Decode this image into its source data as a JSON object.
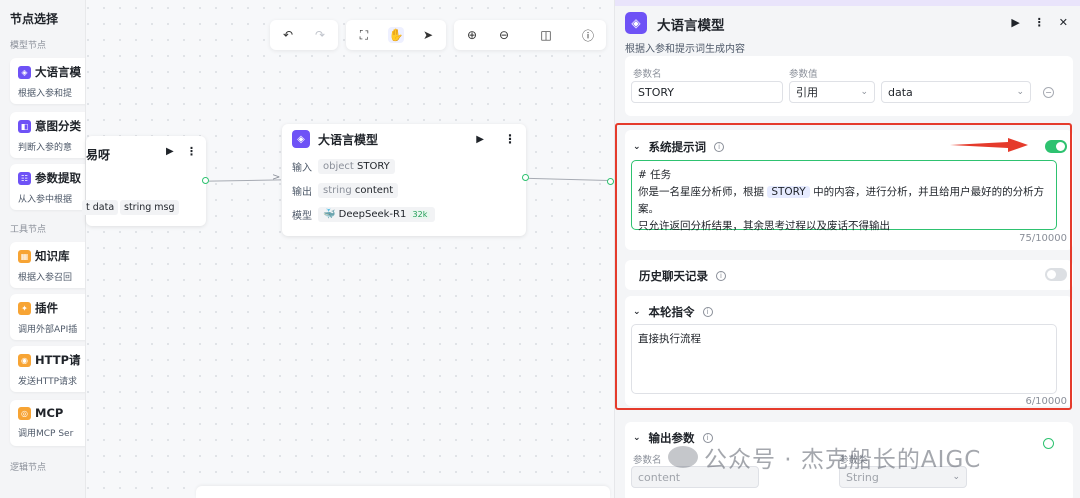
{
  "left_panel": {
    "title": "节点选择",
    "sections": [
      "模型节点",
      "工具节点",
      "逻辑节点"
    ],
    "items": [
      {
        "icon": "llm-icon",
        "label": "大语言模",
        "desc": "根据入参和提"
      },
      {
        "icon": "intent-icon",
        "label": "意图分类",
        "desc": "判断入参的意"
      },
      {
        "icon": "param-icon",
        "label": "参数提取",
        "desc": "从入参中根据"
      },
      {
        "icon": "knowledge-icon",
        "label": "知识库",
        "desc": "根据入参召回"
      },
      {
        "icon": "plugin-icon",
        "label": "插件",
        "desc": "调用外部API插"
      },
      {
        "icon": "http-icon",
        "label": "HTTP请",
        "desc": "发送HTTP请求"
      },
      {
        "icon": "mcp-icon",
        "label": "MCP",
        "desc": "调用MCP Ser"
      }
    ]
  },
  "toolbar": {
    "icons": [
      "undo-icon",
      "redo-icon",
      "fullscreen-icon",
      "hand-icon",
      "pointer-icon",
      "zoom-in-icon",
      "zoom-out-icon",
      "layout-icon",
      "help-icon"
    ]
  },
  "node_left": {
    "title": "易呀",
    "inputs": [
      "t data",
      "string msg"
    ]
  },
  "node_main": {
    "title": "大语言模型",
    "input_label": "输入",
    "input_type": "object",
    "input_name": "STORY",
    "output_label": "输出",
    "output_type": "string",
    "output_name": "content",
    "model_label": "模型",
    "model_name": "DeepSeek-R1",
    "model_badge": "32k"
  },
  "right_panel": {
    "title": "大语言模型",
    "subtitle": "根据入参和提示词生成内容",
    "params": {
      "name_label": "参数名",
      "value_label": "参数值",
      "name": "STORY",
      "ref_type": "引用",
      "ref_value": "data"
    },
    "system_prompt": {
      "title": "系统提示词",
      "enabled": true,
      "line1": "# 任务",
      "line2_a": "你是一名星座分析师，根据",
      "line2_var": "STORY",
      "line2_b": "中的内容，进行分析，并且给用户最好的的分析方案。",
      "line3": "只允许返回分析结果，其余思考过程以及废话不得输出",
      "counter": "75/10000"
    },
    "history": {
      "title": "历史聊天记录",
      "enabled": false
    },
    "instruction": {
      "title": "本轮指令",
      "text": "直接执行流程",
      "counter": "6/10000"
    },
    "output": {
      "title": "输出参数",
      "name_label": "参数名",
      "type_label": "参数类",
      "name": "content",
      "type": "String"
    }
  },
  "watermark": "公众号 · 杰克船长的AIGC",
  "colors": {
    "accent": "#6e52f6",
    "toggle_on": "#2ec270",
    "highlight": "#e53b2c"
  }
}
